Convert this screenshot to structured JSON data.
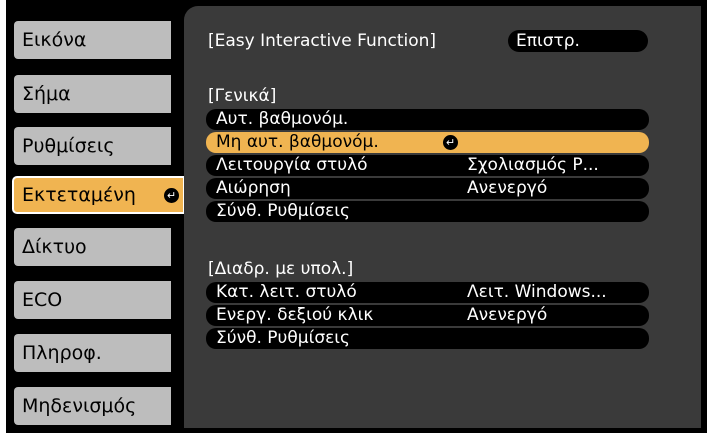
{
  "sidebar": {
    "items": [
      {
        "label": "Εικόνα"
      },
      {
        "label": "Σήμα"
      },
      {
        "label": "Ρυθμίσεις"
      },
      {
        "label": "Εκτεταμένη"
      },
      {
        "label": "Δίκτυο"
      },
      {
        "label": "ECO"
      },
      {
        "label": "Πληροφ."
      },
      {
        "label": "Μηδενισμός"
      }
    ],
    "active_index": 3
  },
  "header": {
    "title": "[Easy Interactive Function]",
    "back_label": "Επιστρ."
  },
  "general": {
    "heading": "[Γενικά]",
    "rows": [
      {
        "label": "Αυτ. βαθμονόμ.",
        "value": ""
      },
      {
        "label": "Μη αυτ. βαθμονόμ.",
        "value": ""
      },
      {
        "label": "Λειτουργία στυλό",
        "value": "Σχολιασμός Ρ..."
      },
      {
        "label": "Αιώρηση",
        "value": "Ανενεργό"
      },
      {
        "label": "Σύνθ. Ρυθμίσεις",
        "value": ""
      }
    ]
  },
  "pc": {
    "heading": "[Διαδρ. με υπολ.]",
    "rows": [
      {
        "label": "Κατ. λειτ. στυλό",
        "value": "Λειτ. Windows..."
      },
      {
        "label": "Ενεργ. δεξιού κλικ",
        "value": "Ανενεργό"
      },
      {
        "label": "Σύνθ. Ρυθμίσεις",
        "value": ""
      }
    ]
  },
  "icons": {
    "enter": "enter-icon"
  },
  "colors": {
    "highlight": "#f0b451",
    "tab_bg": "#bdbdbd",
    "panel_bg": "#3a3a3a"
  }
}
